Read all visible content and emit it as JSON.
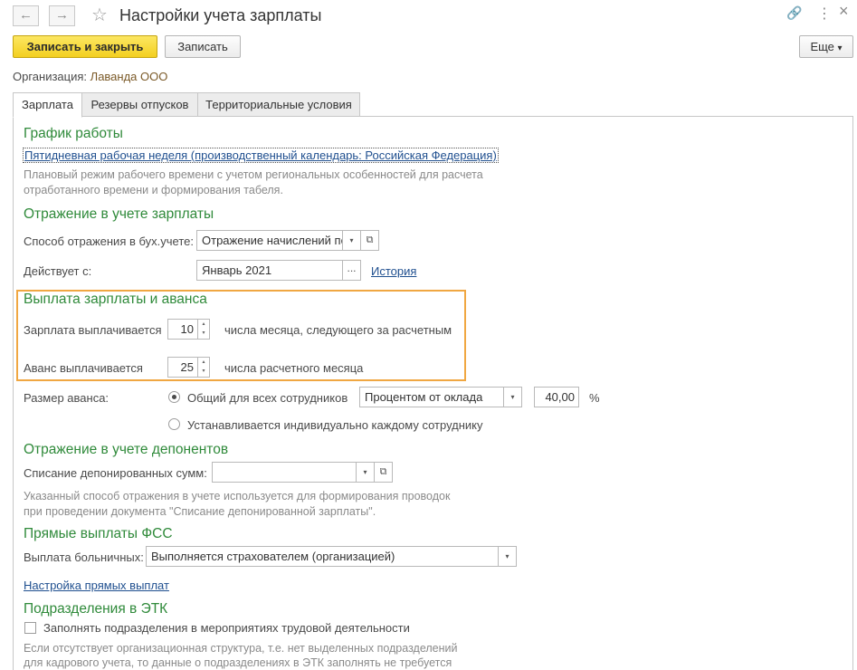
{
  "header": {
    "title": "Настройки учета зарплаты",
    "back_icon": "←",
    "forward_icon": "→",
    "star_icon": "☆",
    "link_icon": "🔗",
    "more_icon": "⋮",
    "close_icon": "×"
  },
  "toolbar": {
    "save_close_label": "Записать и закрыть",
    "save_label": "Записать",
    "more_label": "Еще",
    "more_arrow": "▾"
  },
  "organization": {
    "label": "Организация:",
    "value": "Лаванда ООО"
  },
  "tabs": [
    {
      "label": "Зарплата",
      "active": true
    },
    {
      "label": "Резервы отпусков",
      "active": false
    },
    {
      "label": "Территориальные условия",
      "active": false
    }
  ],
  "schedule": {
    "heading": "График работы",
    "link": "Пятидневная рабочая неделя (производственный календарь: Российская Федерация)",
    "hint1": "Плановый режим рабочего времени с учетом региональных особенностей для расчета",
    "hint2": "отработанного времени и формирования табеля."
  },
  "accounting": {
    "heading": "Отражение в учете зарплаты",
    "method_label": "Способ отражения в бух.учете:",
    "method_value": "Отражение начислений по",
    "effective_label": "Действует с:",
    "effective_value": "Январь 2021",
    "ellipsis": "...",
    "history_link": "История"
  },
  "payment": {
    "heading": "Выплата зарплаты и аванса",
    "salary_label": "Зарплата выплачивается",
    "salary_day": "10",
    "salary_suffix": "числа месяца, следующего за расчетным",
    "advance_label": "Аванс выплачивается",
    "advance_day": "25",
    "advance_suffix": "числа расчетного месяца"
  },
  "advance_size": {
    "label": "Размер аванса:",
    "option_common": "Общий для всех сотрудников",
    "option_individual": "Устанавливается индивидуально каждому сотруднику",
    "method_value": "Процентом от оклада",
    "percent_value": "40,00",
    "percent_unit": "%"
  },
  "deponents": {
    "heading": "Отражение в учете депонентов",
    "writeoff_label": "Списание депонированных сумм:",
    "writeoff_value": "",
    "hint1": "Указанный способ отражения в учете используется для формирования проводок",
    "hint2": "при проведении документа \"Списание депонированной зарплаты\"."
  },
  "fss": {
    "heading": "Прямые выплаты ФСС",
    "sick_label": "Выплата больничных:",
    "sick_value": "Выполняется страхователем (организацией)",
    "settings_link": "Настройка прямых выплат"
  },
  "etk": {
    "heading": "Подразделения в ЭТК",
    "checkbox_label": "Заполнять подразделения в мероприятиях трудовой деятельности",
    "hint1": "Если отсутствует организационная структура, т.е. нет выделенных подразделений",
    "hint2": "для кадрового учета, то данные о подразделениях в ЭТК заполнять не требуется"
  },
  "glyphs": {
    "dropdown": "▾",
    "open": "⧉",
    "spin_up": "▴",
    "spin_down": "▾"
  }
}
